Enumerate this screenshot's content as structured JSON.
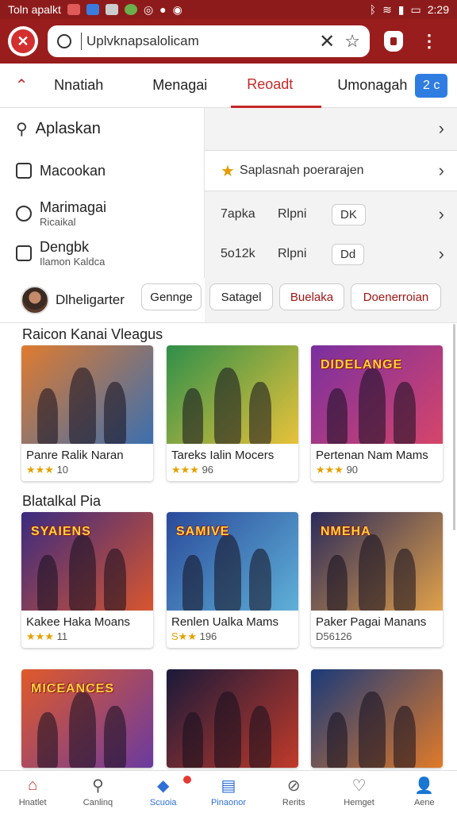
{
  "status_bar": {
    "left_text": "Toln apalkt",
    "time": "2:29"
  },
  "browser": {
    "url": "Uplvknapsalolicam"
  },
  "tabs": {
    "items": [
      {
        "label": "Nnatiah"
      },
      {
        "label": "Menagai"
      },
      {
        "label": "Reoadt",
        "active": true
      },
      {
        "label": "Umonagah"
      }
    ],
    "badge": "2 c"
  },
  "left_menu": [
    {
      "title": "Aplaskan",
      "sub": "",
      "icon": "search-icon"
    },
    {
      "title": "Macookan",
      "sub": "",
      "icon": "checkbox-icon"
    },
    {
      "title": "Marimagai",
      "sub": "Ricaikal",
      "icon": "pin-icon"
    },
    {
      "title": "Dengbk",
      "sub": "Ilamon Kaldca",
      "icon": "tag-icon"
    }
  ],
  "right_panel": {
    "promo": "Saplasnah poerarajen",
    "rows": [
      {
        "col1": "7apka",
        "col2": "Rlpni",
        "pill": "DK"
      },
      {
        "col1": "5o12k",
        "col2": "Rlpni",
        "pill": "Dd"
      }
    ]
  },
  "chips": {
    "user": "Dlheligarter",
    "items": [
      "Gennge",
      "Satagel",
      "Buelaka",
      "Doenerroian"
    ]
  },
  "sections": [
    {
      "title": "Raicon Kanai Vleagus",
      "cards": [
        {
          "title": "Panre Ralik Naran",
          "stars": "★★★",
          "rating": "10",
          "colors": [
            "#e07b2f",
            "#3b6fb0"
          ]
        },
        {
          "title": "Tareks Ialin Mocers",
          "stars": "★★★",
          "rating": "96",
          "colors": [
            "#2f8f4a",
            "#e8c23a"
          ]
        },
        {
          "title": "Pertenan Nam Mams",
          "stars": "★★★",
          "rating": "90",
          "colors": [
            "#7a2fa0",
            "#d6456a"
          ],
          "banner": "DIDELANGE"
        }
      ]
    },
    {
      "title": "Blatalkal Pia",
      "cards": [
        {
          "title": "Kakee Haka Moans",
          "stars": "★★★",
          "rating": "11",
          "colors": [
            "#3a2a80",
            "#d8562f"
          ],
          "banner": "SYAIENS"
        },
        {
          "title": "Renlen Ualka Mams",
          "stars": "S★★",
          "rating": "196",
          "colors": [
            "#2a4a9a",
            "#5fb0d8"
          ],
          "banner": "SAMIVE"
        },
        {
          "title": "Paker Pagai Manans",
          "stars": "",
          "rating": "D56126",
          "colors": [
            "#2a2a5a",
            "#e0a04a"
          ],
          "banner": "NMEHA"
        }
      ]
    },
    {
      "title": "",
      "cards": [
        {
          "title": "",
          "stars": "",
          "rating": "",
          "colors": [
            "#e05a2a",
            "#6a3aa0"
          ],
          "banner": "MICEANCES"
        },
        {
          "title": "",
          "stars": "",
          "rating": "",
          "colors": [
            "#1a1a3a",
            "#c03a2a"
          ]
        },
        {
          "title": "",
          "stars": "",
          "rating": "",
          "colors": [
            "#1a3a7a",
            "#e07a2a"
          ]
        }
      ]
    }
  ],
  "bottom_nav": [
    {
      "label": "Hnatlet",
      "icon": "home-icon"
    },
    {
      "label": "Canlinq",
      "icon": "search-icon"
    },
    {
      "label": "Scuoia",
      "icon": "chat-icon",
      "active": true
    },
    {
      "label": "Pinaonor",
      "icon": "folder-icon",
      "active": true
    },
    {
      "label": "Rerits",
      "icon": "compass-icon"
    },
    {
      "label": "Hemget",
      "icon": "heart-icon"
    },
    {
      "label": "Aene",
      "icon": "profile-icon"
    }
  ]
}
